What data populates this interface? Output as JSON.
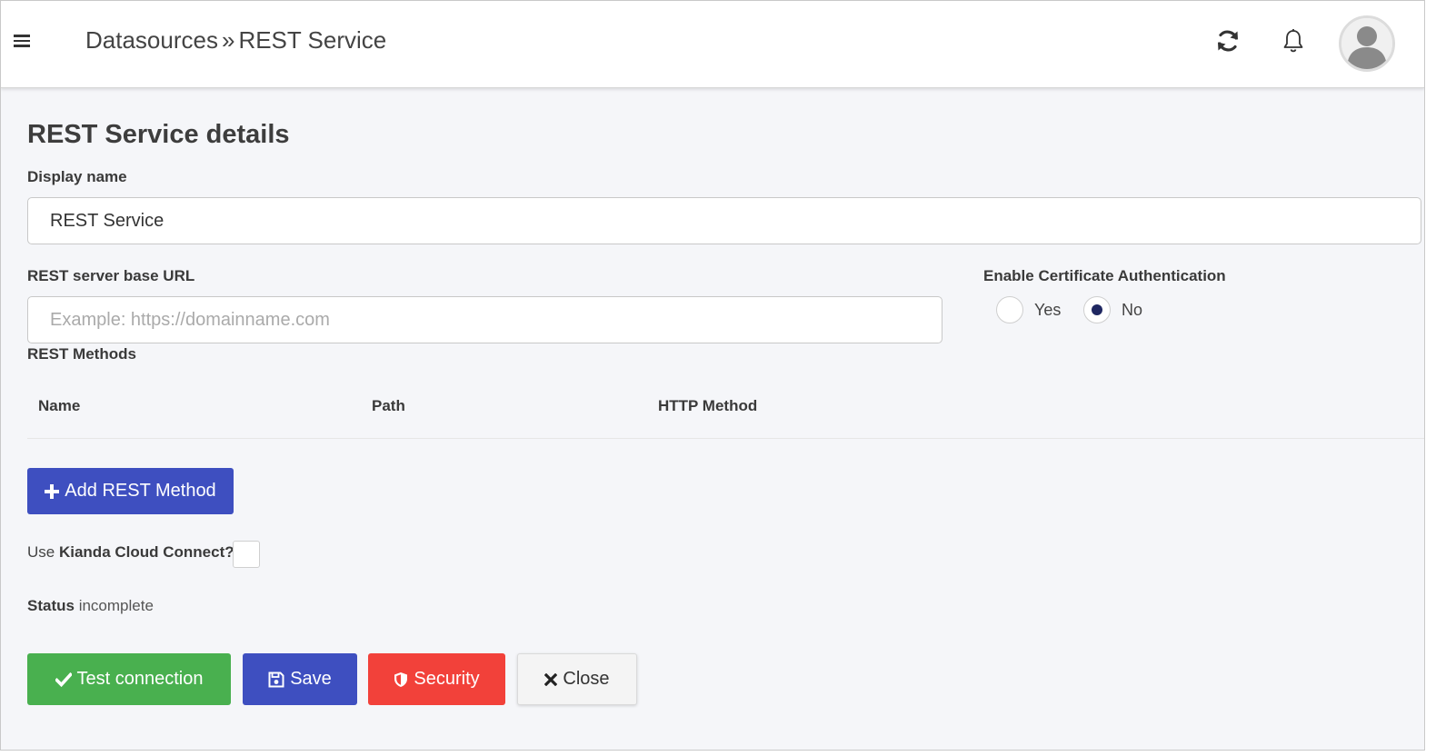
{
  "header": {
    "breadcrumb_parent": "Datasources",
    "breadcrumb_separator": "»",
    "breadcrumb_current": "REST Service",
    "icons": [
      "menu-icon",
      "refresh-icon",
      "bell-icon",
      "user-avatar"
    ]
  },
  "form": {
    "title": "REST Service details",
    "display_name_label": "Display name",
    "display_name_value": "REST Service",
    "base_url_label": "REST server base URL",
    "base_url_value": "",
    "base_url_placeholder": "Example: https://domainname.com",
    "cert_auth_label": "Enable Certificate Authentication",
    "cert_auth_options": {
      "yes": "Yes",
      "no": "No"
    },
    "cert_auth_selected": "No",
    "methods_label": "REST Methods",
    "methods_table": {
      "columns": [
        "Name",
        "Path",
        "HTTP Method"
      ],
      "rows": []
    },
    "add_method_label": "Add REST Method",
    "cloud_connect_prefix": "Use",
    "cloud_connect_bold": "Kianda Cloud Connect?",
    "cloud_connect_checked": false,
    "status_label": "Status",
    "status_value": "incomplete"
  },
  "actions": {
    "test_label": "Test connection",
    "save_label": "Save",
    "security_label": "Security",
    "close_label": "Close"
  },
  "colors": {
    "primary": "#3e4fc0",
    "success": "#49b04f",
    "danger": "#f2413a",
    "radio_selected": "#1f2761",
    "background": "#f5f6f9"
  }
}
